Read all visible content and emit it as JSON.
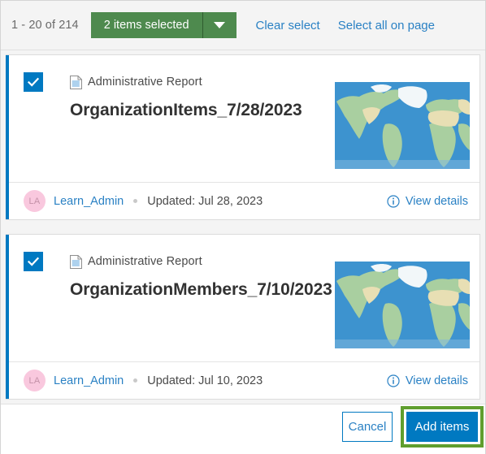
{
  "toolbar": {
    "pager_count": "1 - 20 of 214",
    "selected_label": "2 items selected",
    "caret_icon": "chevron-down-icon",
    "clear_select": "Clear select",
    "select_all": "Select all on page",
    "accent_green": "#4e8a4e",
    "link_blue": "#2a81c4"
  },
  "results": [
    {
      "checked": true,
      "type_icon": "document-icon",
      "type_label": "Administrative Report",
      "title": "OrganizationItems_7/28/2023",
      "thumbnail": "world-map-thumbnail",
      "owner_initials": "LA",
      "owner": "Learn_Admin",
      "updated": "Updated: Jul 28, 2023",
      "details_icon": "info-icon",
      "details_label": "View details"
    },
    {
      "checked": true,
      "type_icon": "document-icon",
      "type_label": "Administrative Report",
      "title": "OrganizationMembers_7/10/2023",
      "thumbnail": "world-map-thumbnail",
      "owner_initials": "LA",
      "owner": "Learn_Admin",
      "updated": "Updated: Jul 10, 2023",
      "details_icon": "info-icon",
      "details_label": "View details"
    }
  ],
  "footer": {
    "cancel_label": "Cancel",
    "add_items_label": "Add items",
    "primary_blue": "#0079c1",
    "highlight_green": "#5f9e2e"
  }
}
